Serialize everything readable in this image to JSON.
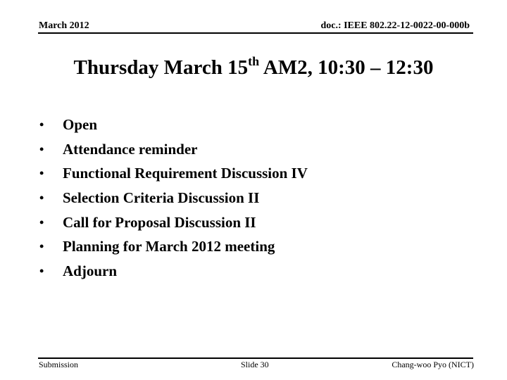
{
  "header": {
    "date": "March 2012",
    "doc_id": "doc.: IEEE 802.22-12-0022-00-000b"
  },
  "title": {
    "prefix": "Thursday March 15",
    "superscript": "th",
    "suffix": " AM2, 10:30 – 12:30"
  },
  "agenda": {
    "bullet": "•",
    "items": [
      "Open",
      "Attendance reminder",
      "Functional Requirement Discussion IV",
      "Selection Criteria Discussion II",
      "Call for Proposal Discussion II",
      "Planning for March 2012 meeting",
      "Adjourn"
    ]
  },
  "footer": {
    "left": "Submission",
    "center": "Slide 30",
    "right": "Chang-woo Pyo (NICT)"
  }
}
